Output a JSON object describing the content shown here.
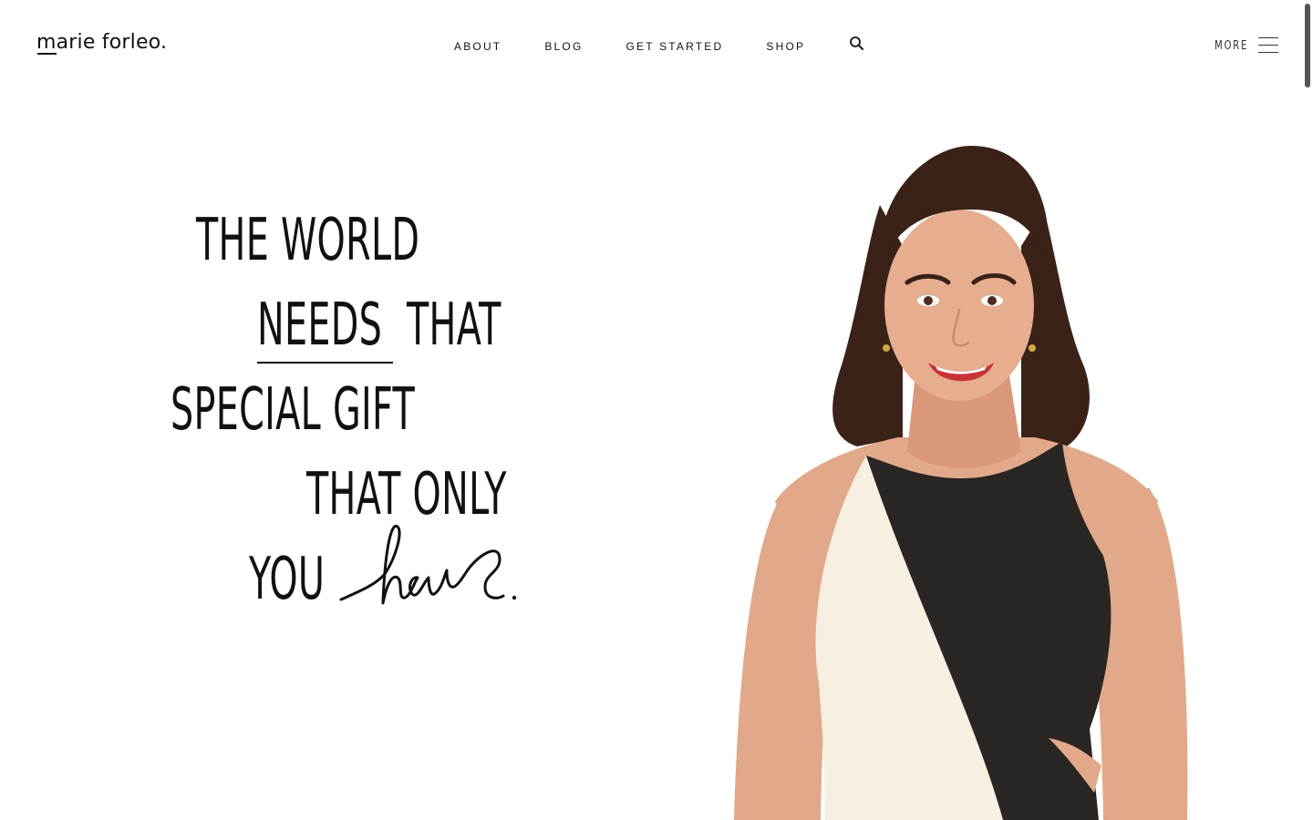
{
  "header": {
    "logo": "marie forleo.",
    "nav": [
      "ABOUT",
      "BLOG",
      "GET STARTED",
      "SHOP"
    ],
    "more_label": "MORE"
  },
  "hero": {
    "lines": [
      "THE WORLD",
      "NEEDS",
      "THAT",
      "SPECIAL GIFT",
      "THAT ONLY",
      "YOU"
    ],
    "script_word": "have",
    "period": "."
  },
  "icons": {
    "search": "search-icon",
    "menu": "hamburger-menu-icon"
  },
  "colors": {
    "text": "#111111",
    "skin": "#e2a88a",
    "hair": "#3b2218",
    "dress_dark": "#2a2624",
    "dress_light": "#f7efe2",
    "lips": "#c8323a"
  }
}
